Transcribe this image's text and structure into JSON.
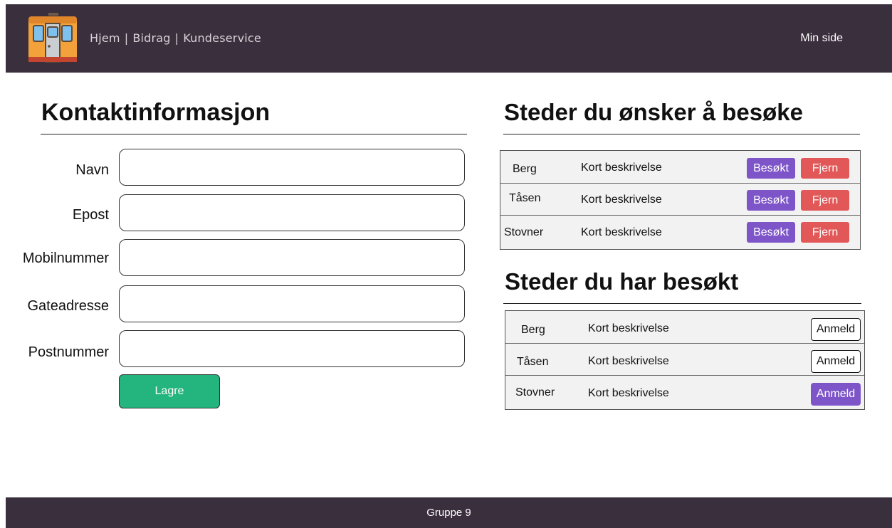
{
  "header": {
    "logo_icon": "train-icon",
    "nav": [
      "Hjem",
      "Bidrag",
      "Kundeservice"
    ],
    "separator": "|",
    "min_side": "Min side"
  },
  "contact": {
    "title": "Kontaktinformasjon",
    "fields": [
      {
        "label": "Navn",
        "value": ""
      },
      {
        "label": "Epost",
        "value": ""
      },
      {
        "label": "Mobilnummer",
        "value": ""
      },
      {
        "label": "Gateadresse",
        "value": ""
      },
      {
        "label": "Postnummer",
        "value": ""
      }
    ],
    "save_label": "Lagre"
  },
  "wish": {
    "title": "Steder du ønsker å besøke",
    "rows": [
      {
        "place": "Berg",
        "desc": "Kort beskrivelse",
        "visited_label": "Besøkt",
        "remove_label": "Fjern"
      },
      {
        "place": "Tåsen",
        "desc": "Kort beskrivelse",
        "visited_label": "Besøkt",
        "remove_label": "Fjern"
      },
      {
        "place": "Stovner",
        "desc": "Kort beskrivelse",
        "visited_label": "Besøkt",
        "remove_label": "Fjern"
      }
    ]
  },
  "visited": {
    "title": "Steder du har besøkt",
    "rows": [
      {
        "place": "Berg",
        "desc": "Kort beskrivelse",
        "review_label": "Anmeld"
      },
      {
        "place": "Tåsen",
        "desc": "Kort beskrivelse",
        "review_label": "Anmeld"
      },
      {
        "place": "Stovner",
        "desc": "Kort beskrivelse",
        "review_label": "Anmeld"
      }
    ]
  },
  "footer": {
    "text": "Gruppe 9"
  },
  "colors": {
    "header_bg": "#3a2f3d",
    "save_green": "#24b47e",
    "visited_purple": "#7e55c9",
    "remove_red": "#e25757",
    "table_bg": "#f2f2f2"
  }
}
